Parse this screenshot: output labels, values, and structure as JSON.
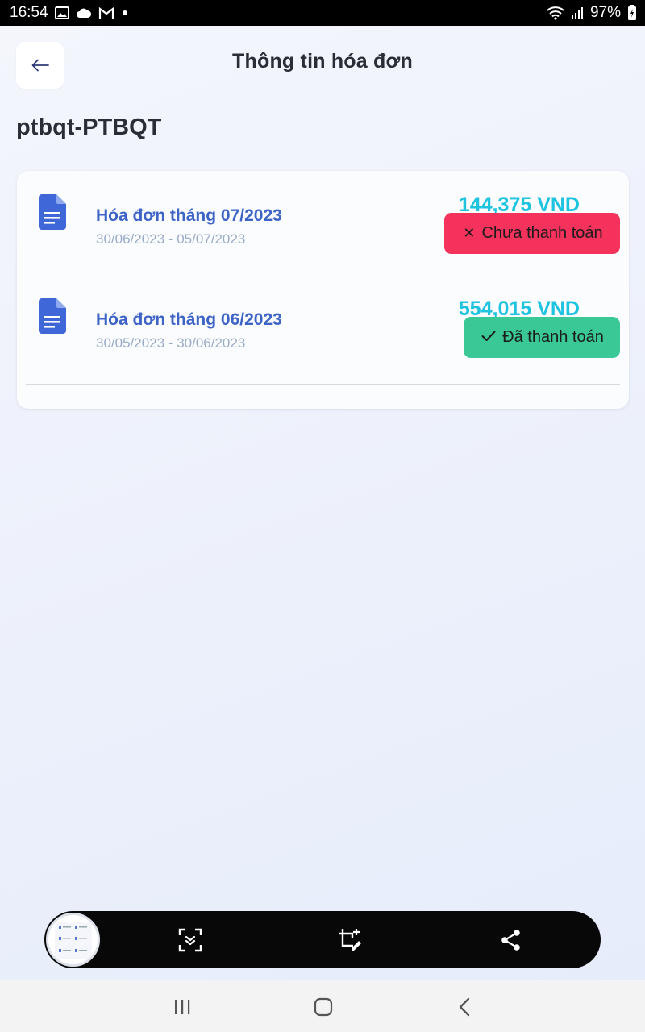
{
  "status_bar": {
    "time": "16:54",
    "battery_percent": "97%",
    "icons": [
      "image-icon",
      "cloud-icon",
      "gmail-icon",
      "dot-icon",
      "wifi-icon",
      "signal-icon",
      "battery-icon"
    ]
  },
  "header": {
    "title": "Thông tin hóa đơn",
    "back_icon": "arrow-left-icon"
  },
  "account": {
    "name": "ptbqt-PTBQT"
  },
  "invoices": [
    {
      "title": "Hóa đơn tháng 07/2023",
      "period": "30/06/2023 - 05/07/2023",
      "amount": "144,375 VND",
      "status_label": "Chưa thanh toán",
      "status_icon": "close-icon",
      "status_color": "#f5325c"
    },
    {
      "title": "Hóa đơn tháng 06/2023",
      "period": "30/05/2023 - 30/06/2023",
      "amount": "554,015 VND",
      "status_label": "Đã thanh toán",
      "status_icon": "check-icon",
      "status_color": "#3ac896"
    }
  ],
  "colors": {
    "invoice_title": "#3d63c7",
    "amount": "#1ec3e0",
    "period": "#9aabc8"
  },
  "screenshot_toolbar": {
    "buttons": [
      "scroll-capture-icon",
      "crop-edit-icon",
      "share-icon"
    ]
  },
  "nav_bar": {
    "buttons": [
      "recent-apps-icon",
      "home-icon",
      "back-icon"
    ]
  }
}
